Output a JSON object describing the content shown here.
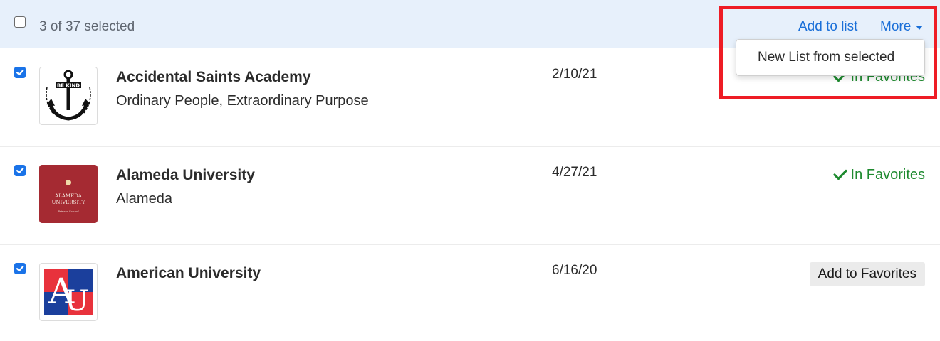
{
  "toolbar": {
    "selection_count": "3 of 37 selected",
    "add_to_list": "Add to list",
    "more": "More",
    "select_all_checked": false
  },
  "more_menu": {
    "items": [
      {
        "label": "New List from selected"
      }
    ]
  },
  "rows": [
    {
      "name": "Accidental Saints Academy",
      "subtitle": "Ordinary People, Extraordinary Purpose",
      "date": "2/10/21",
      "status": "In Favorites",
      "selected": true,
      "logo": "anchor-logo",
      "logo_text": [
        "BE KIND"
      ]
    },
    {
      "name": "Alameda University",
      "subtitle": "Alameda",
      "date": "4/27/21",
      "status": "In Favorites",
      "selected": true,
      "logo": "alameda-logo",
      "logo_text": [
        "ALAMEDA",
        "UNIVERSITY",
        "Private School"
      ]
    },
    {
      "name": "American University",
      "subtitle": "",
      "date": "6/16/20",
      "status": "Add to Favorites",
      "selected": true,
      "logo": "au-logo",
      "logo_text": [
        "A",
        "U"
      ]
    }
  ],
  "colors": {
    "link": "#1a6fd8",
    "favorite_green": "#1e8a2f",
    "checkbox_blue": "#1a73e8",
    "toolbar_bg": "#e7f0fb",
    "highlight_red": "#ee1c25"
  }
}
